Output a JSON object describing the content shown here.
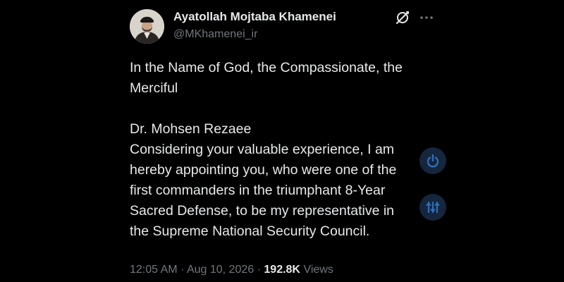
{
  "author": {
    "display_name": "Ayatollah Mojtaba Khamenei",
    "handle": "@MKhamenei_ir"
  },
  "tweet": {
    "text": "In the Name of God, the Compassionate, the\nMerciful\n\nDr. Mohsen Rezaee\nConsidering your valuable experience, I am\nhereby appointing you, who were one of the\nfirst commanders in the triumphant 8-Year\nSacred Defense, to be my representative in\nthe Supreme National Security Council.",
    "time": "12:05 AM",
    "date": "Aug 10, 2026",
    "separator": "·",
    "views_count": "192.8K",
    "views_label": "Views"
  },
  "icons": {
    "grok": "grok-icon",
    "more": "more-icon",
    "power": "power-icon",
    "sliders": "sliders-icon"
  },
  "colors": {
    "background": "#000000",
    "primary_text": "#e7e9ea",
    "secondary_text": "#71767b",
    "floating_button_bg": "#15263d",
    "floating_button_icon": "#2f6fb8"
  }
}
